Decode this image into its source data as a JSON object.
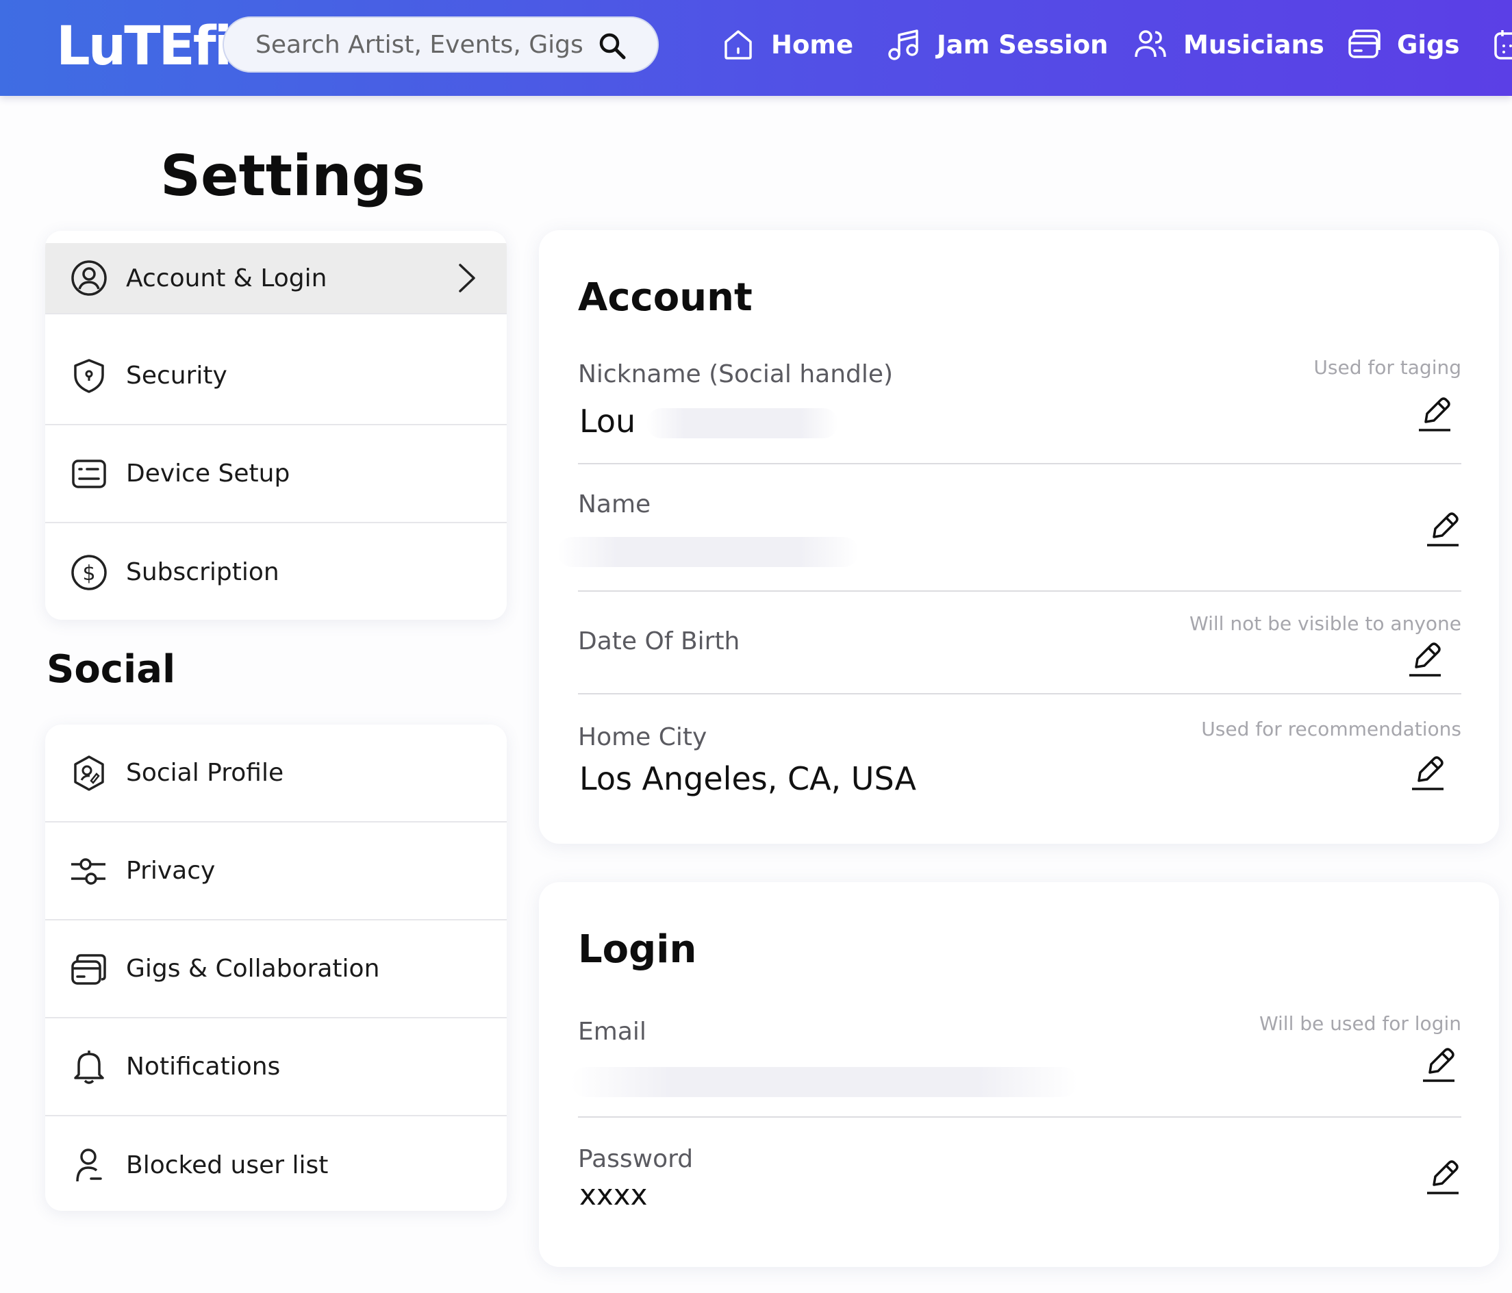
{
  "brand": {
    "logo_text": "LuTEfish"
  },
  "search": {
    "placeholder": "Search Artist, Events, Gigs"
  },
  "nav": [
    {
      "label": "Home",
      "icon": "home-icon"
    },
    {
      "label": "Jam Session",
      "icon": "music-note-icon"
    },
    {
      "label": "Musicians",
      "icon": "users-icon"
    },
    {
      "label": "Gigs",
      "icon": "card-icon"
    }
  ],
  "page": {
    "title": "Settings",
    "social_title": "Social"
  },
  "menu_account": [
    {
      "label": "Account & Login",
      "icon": "user-circle-icon",
      "active": true
    },
    {
      "label": "Security",
      "icon": "shield-icon"
    },
    {
      "label": "Device Setup",
      "icon": "keyboard-icon"
    },
    {
      "label": "Subscription",
      "icon": "dollar-circle-icon"
    }
  ],
  "menu_social": [
    {
      "label": "Social Profile",
      "icon": "profile-badge-icon"
    },
    {
      "label": "Privacy",
      "icon": "sliders-icon"
    },
    {
      "label": "Gigs & Collaboration",
      "icon": "cards-icon"
    },
    {
      "label": "Notifications",
      "icon": "bell-icon"
    },
    {
      "label": "Blocked user list",
      "icon": "user-minus-icon"
    }
  ],
  "account": {
    "title": "Account",
    "nickname": {
      "label": "Nickname (Social handle)",
      "value": "Lou",
      "hint": "Used for taging"
    },
    "name": {
      "label": "Name",
      "value": ""
    },
    "dob": {
      "label": "Date Of Birth",
      "hint": "Will not be visible to anyone"
    },
    "city": {
      "label": "Home City",
      "value": "Los Angeles, CA, USA",
      "hint": "Used for recommendations"
    }
  },
  "login": {
    "title": "Login",
    "email": {
      "label": "Email",
      "value": "",
      "hint": "Will be used for login"
    },
    "password": {
      "label": "Password",
      "value": "xxxx"
    }
  },
  "colors": {
    "nav_start": "#3f6de3",
    "nav_end": "#5b3fe6",
    "active_row": "#ececec"
  }
}
